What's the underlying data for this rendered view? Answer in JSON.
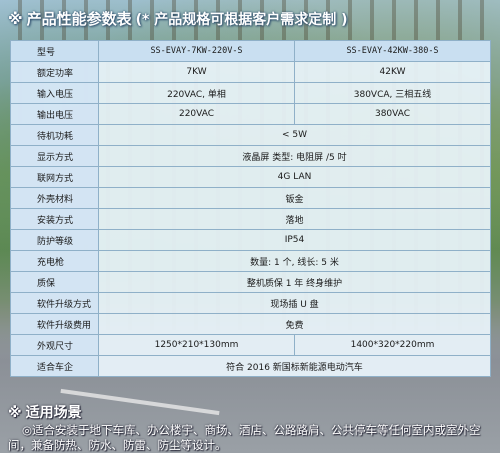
{
  "heading": {
    "mark": "※",
    "title": "产品性能参数表",
    "note": "(* 产品规格可根据客户需求定制 )"
  },
  "table": {
    "rows": [
      {
        "label": "型号",
        "a": "SS-EVAY-7KW-220V-S",
        "b": "SS-EVAY-42KW-380-S"
      },
      {
        "label": "额定功率",
        "a": "7KW",
        "b": "42KW"
      },
      {
        "label": "输入电压",
        "a": "220VAC, 单相",
        "b": "380VCA, 三相五线"
      },
      {
        "label": "输出电压",
        "a": "220VAC",
        "b": "380VAC"
      },
      {
        "label": "待机功耗",
        "value": "< 5W"
      },
      {
        "label": "显示方式",
        "value": "液晶屏  类型: 电阻屏 /5 吋"
      },
      {
        "label": "联网方式",
        "value": "4G    LAN"
      },
      {
        "label": "外壳材料",
        "value": "钣金"
      },
      {
        "label": "安装方式",
        "value": "落地"
      },
      {
        "label": "防护等级",
        "value": "IP54"
      },
      {
        "label": "充电枪",
        "value": "数量: 1 个, 线长: 5 米"
      },
      {
        "label": "质保",
        "value": "整机质保 1 年  终身维护"
      },
      {
        "label": "软件升级方式",
        "value": "现场插 U 盘"
      },
      {
        "label": "软件升级费用",
        "value": "免费"
      },
      {
        "label": "外观尺寸",
        "a": "1250*210*130mm",
        "b": "1400*320*220mm"
      },
      {
        "label": "适合车企",
        "value": "符合 2016 新国标新能源电动汽车"
      }
    ]
  },
  "usage": {
    "mark": "※",
    "title": "适用场景",
    "text": "◎适合安装于地下车库、办公楼宇、商场、酒店、公路路肩、公共停车等任何室内或室外空间，兼备防热、防水、防雷、防尘等设计。"
  }
}
